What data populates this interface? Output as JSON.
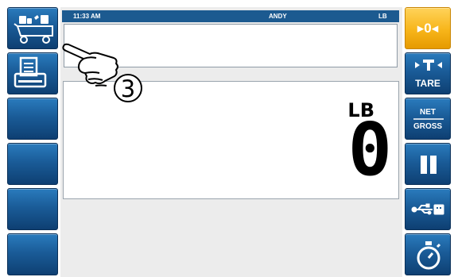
{
  "status": {
    "time": "11:33 AM",
    "user": "ANDY",
    "unit": "LB"
  },
  "message_panel": {
    "text": ""
  },
  "display": {
    "unit": "LB",
    "weight": "0"
  },
  "callout": {
    "number": "③"
  },
  "left_buttons": [
    {
      "name": "checkweigh-cart-button",
      "icon": "cart-scale-icon"
    },
    {
      "name": "print-button",
      "icon": "printer-icon"
    },
    {
      "name": "softkey-3",
      "icon": ""
    },
    {
      "name": "softkey-4",
      "icon": ""
    },
    {
      "name": "softkey-5",
      "icon": ""
    },
    {
      "name": "softkey-6",
      "icon": ""
    }
  ],
  "right_buttons": {
    "zero": {
      "label": "▸0◂"
    },
    "tare": {
      "label": "TARE"
    },
    "net_gross": {
      "top": "NET",
      "bottom": "GROSS"
    },
    "pause": {
      "icon": "pause-icon"
    },
    "usb": {
      "icon": "usb-icon"
    },
    "timer": {
      "icon": "stopwatch-icon"
    }
  },
  "colors": {
    "button_blue": "#1a5c98",
    "zero_yellow": "#f7b51a",
    "status_bar": "#1c5a90"
  }
}
